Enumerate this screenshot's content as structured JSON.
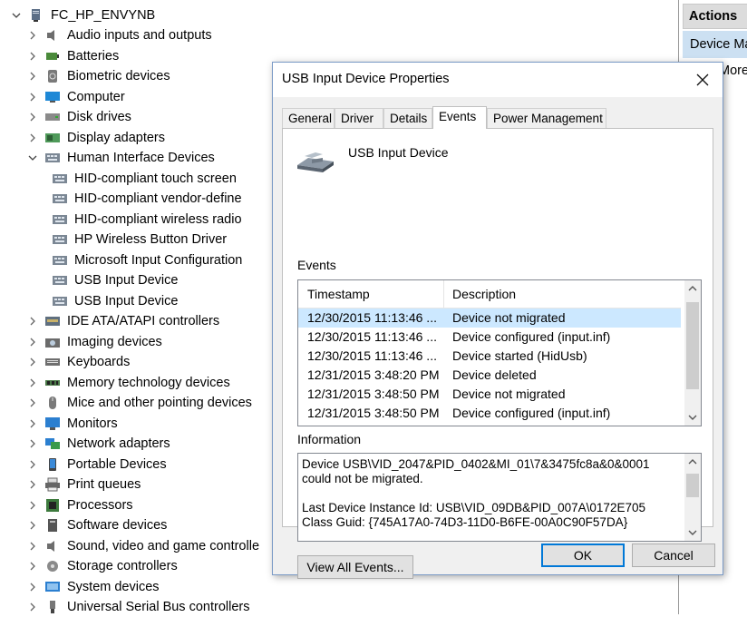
{
  "tree": {
    "root": "FC_HP_ENVYNB",
    "items": [
      {
        "label": "Audio inputs and outputs",
        "icon": "speaker-icon"
      },
      {
        "label": "Batteries",
        "icon": "battery-icon"
      },
      {
        "label": "Biometric devices",
        "icon": "fingerprint-icon"
      },
      {
        "label": "Computer",
        "icon": "computer-icon"
      },
      {
        "label": "Disk drives",
        "icon": "disk-drive-icon"
      },
      {
        "label": "Display adapters",
        "icon": "display-adapter-icon"
      },
      {
        "label": "Human Interface Devices",
        "icon": "hid-icon"
      },
      {
        "label": "HID-compliant touch screen",
        "icon": "hid-icon"
      },
      {
        "label": "HID-compliant vendor-define",
        "icon": "hid-icon"
      },
      {
        "label": "HID-compliant wireless radio",
        "icon": "hid-icon"
      },
      {
        "label": "HP Wireless Button Driver",
        "icon": "hid-icon"
      },
      {
        "label": "Microsoft Input Configuration",
        "icon": "hid-icon"
      },
      {
        "label": "USB Input Device",
        "icon": "hid-icon"
      },
      {
        "label": "USB Input Device",
        "icon": "hid-icon"
      },
      {
        "label": "IDE ATA/ATAPI controllers",
        "icon": "ide-controller-icon"
      },
      {
        "label": "Imaging devices",
        "icon": "camera-icon"
      },
      {
        "label": "Keyboards",
        "icon": "keyboard-icon"
      },
      {
        "label": "Memory technology devices",
        "icon": "memory-icon"
      },
      {
        "label": "Mice and other pointing devices",
        "icon": "mouse-icon"
      },
      {
        "label": "Monitors",
        "icon": "monitor-icon"
      },
      {
        "label": "Network adapters",
        "icon": "network-adapter-icon"
      },
      {
        "label": "Portable Devices",
        "icon": "portable-device-icon"
      },
      {
        "label": "Print queues",
        "icon": "printer-icon"
      },
      {
        "label": "Processors",
        "icon": "processor-icon"
      },
      {
        "label": "Software devices",
        "icon": "software-device-icon"
      },
      {
        "label": "Sound, video and game controlle",
        "icon": "speaker-icon"
      },
      {
        "label": "Storage controllers",
        "icon": "storage-controller-icon"
      },
      {
        "label": "System devices",
        "icon": "system-device-icon"
      },
      {
        "label": "Universal Serial Bus controllers",
        "icon": "usb-icon"
      }
    ]
  },
  "actions": {
    "header": "Actions",
    "selected": "Device Ma",
    "more": "More"
  },
  "dialog": {
    "title": "USB Input Device Properties",
    "tabs": [
      "General",
      "Driver",
      "Details",
      "Events",
      "Power Management"
    ],
    "active_tab": "Events",
    "device_name": "USB Input Device",
    "events_label": "Events",
    "columns": [
      "Timestamp",
      "Description"
    ],
    "events": [
      {
        "timestamp": "12/30/2015 11:13:46 ...",
        "description": "Device not migrated",
        "selected": true
      },
      {
        "timestamp": "12/30/2015 11:13:46 ...",
        "description": "Device configured (input.inf)"
      },
      {
        "timestamp": "12/30/2015 11:13:46 ...",
        "description": "Device started (HidUsb)"
      },
      {
        "timestamp": "12/31/2015 3:48:20 PM",
        "description": "Device deleted"
      },
      {
        "timestamp": "12/31/2015 3:48:50 PM",
        "description": "Device not migrated"
      },
      {
        "timestamp": "12/31/2015 3:48:50 PM",
        "description": "Device configured (input.inf)"
      }
    ],
    "information_label": "Information",
    "information_text": "Device USB\\VID_2047&PID_0402&MI_01\\7&3475fc8a&0&0001\ncould not be migrated.\n\nLast Device Instance Id: USB\\VID_09DB&PID_007A\\0172E705\nClass Guid: {745A17A0-74D3-11D0-B6FE-00A0C90F57DA}",
    "view_all_button": "View All Events...",
    "ok_button": "OK",
    "cancel_button": "Cancel"
  },
  "colors": {
    "selection": "#cce8ff",
    "accent": "#0078d7",
    "dialog_bg": "#f0f0f0"
  }
}
